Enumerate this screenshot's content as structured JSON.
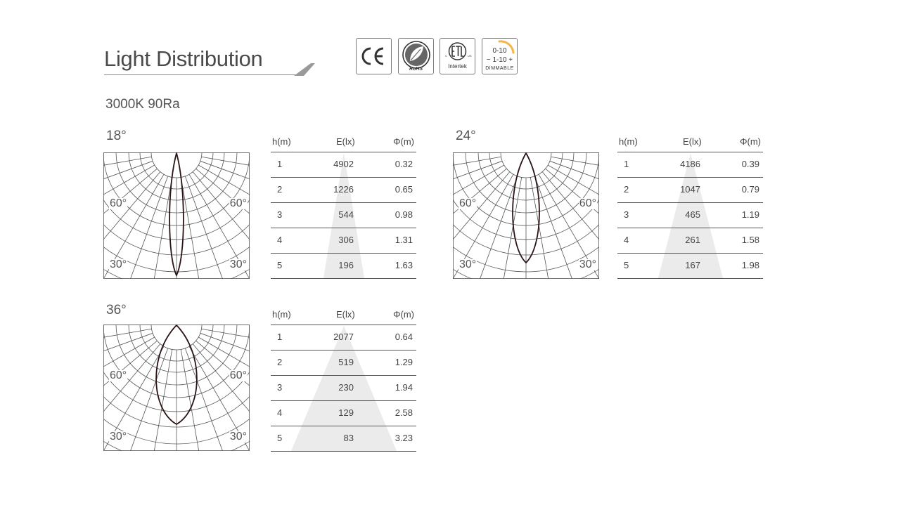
{
  "header": {
    "title": "Light Distribution",
    "certifications": [
      {
        "icon": "ce-mark-icon",
        "label": ""
      },
      {
        "icon": "rohs-leaf-icon",
        "label": "RoHS"
      },
      {
        "icon": "etl-intertek-icon",
        "label": "Intertek"
      },
      {
        "icon": "dimmable-icon",
        "label": "DIMMABLE",
        "top": "0-10",
        "middle": "1-10"
      }
    ]
  },
  "subtitle": "3000K  90Ra",
  "polar_labels": {
    "upper": "60°",
    "lower": "30°"
  },
  "table_headers": {
    "h": "h(m)",
    "e": "E(lx)",
    "phi": "Φ(m)"
  },
  "colors": {
    "curve": "#2a1414",
    "grid": "#555555",
    "cone": "#ebebeb",
    "rule": "#555555"
  },
  "beams": [
    {
      "angle": "18°",
      "rows": [
        {
          "h": "1",
          "e": "4902",
          "phi": "0.32"
        },
        {
          "h": "2",
          "e": "1226",
          "phi": "0.65"
        },
        {
          "h": "3",
          "e": "544",
          "phi": "0.98"
        },
        {
          "h": "4",
          "e": "306",
          "phi": "1.31"
        },
        {
          "h": "5",
          "e": "196",
          "phi": "1.63"
        }
      ]
    },
    {
      "angle": "24°",
      "rows": [
        {
          "h": "1",
          "e": "4186",
          "phi": "0.39"
        },
        {
          "h": "2",
          "e": "1047",
          "phi": "0.79"
        },
        {
          "h": "3",
          "e": "465",
          "phi": "1.19"
        },
        {
          "h": "4",
          "e": "261",
          "phi": "1.58"
        },
        {
          "h": "5",
          "e": "167",
          "phi": "1.98"
        }
      ]
    },
    {
      "angle": "36°",
      "rows": [
        {
          "h": "1",
          "e": "2077",
          "phi": "0.64"
        },
        {
          "h": "2",
          "e": "519",
          "phi": "1.29"
        },
        {
          "h": "3",
          "e": "230",
          "phi": "1.94"
        },
        {
          "h": "4",
          "e": "129",
          "phi": "2.58"
        },
        {
          "h": "5",
          "e": "83",
          "phi": "3.23"
        }
      ]
    }
  ]
}
